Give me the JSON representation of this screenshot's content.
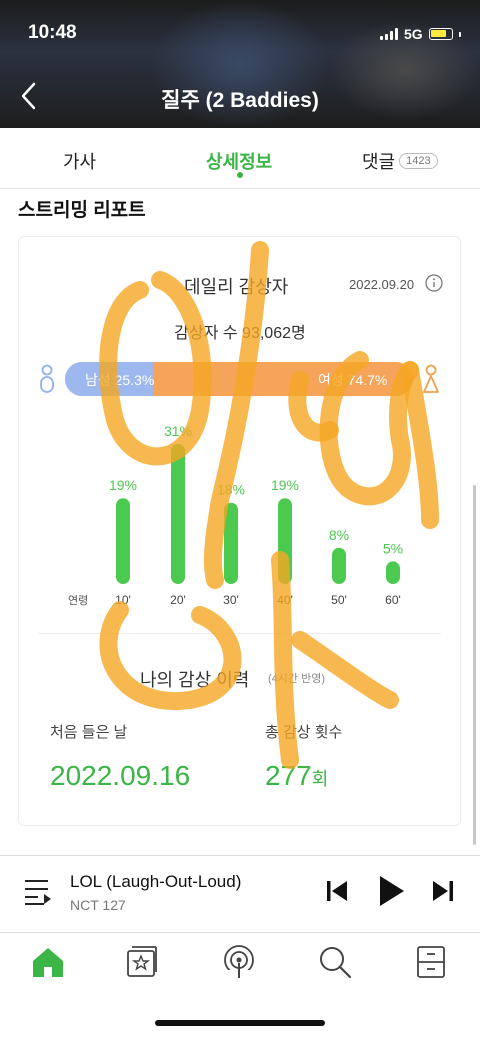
{
  "status_bar": {
    "time": "10:48",
    "network": "5G"
  },
  "header": {
    "title": "질주 (2 Baddies)",
    "back_icon": "chevron-left-icon"
  },
  "tabs": [
    {
      "label": "가사",
      "active": false
    },
    {
      "label": "상세정보",
      "active": true
    },
    {
      "label": "댓글",
      "badge": "1423",
      "active": false
    }
  ],
  "section": {
    "title": "스트리밍 리포트"
  },
  "daily": {
    "title": "데일리 감상자",
    "date": "2022.09.20",
    "listeners_text": "감상자 수 93,062명",
    "male_label": "남성 25.3%",
    "female_label": "여성 74.7%",
    "male_ratio": 0.253,
    "colors": {
      "male": "#9db8ef",
      "female": "#f5a45a",
      "bar_green": "#4cc94f"
    }
  },
  "chart_data": {
    "type": "bar",
    "xlabel": "연령",
    "categories": [
      "10'",
      "20'",
      "30'",
      "40'",
      "50'",
      "60'"
    ],
    "values": [
      19,
      31,
      18,
      19,
      8,
      5
    ],
    "value_labels": [
      "19%",
      "31%",
      "18%",
      "19%",
      "8%",
      "5%"
    ],
    "ylim": [
      0,
      31
    ]
  },
  "history": {
    "title": "나의 감상 이력",
    "note": "(4시간 반영)",
    "first_label": "처음 들은 날",
    "first_value": "2022.09.16",
    "count_label": "총 감상 횟수",
    "count_value": "277",
    "count_unit": "회"
  },
  "player": {
    "song": "LOL (Laugh-Out-Loud)",
    "artist": "NCT 127"
  },
  "bottom_nav": [
    {
      "name": "home-icon",
      "active": true
    },
    {
      "name": "playlist-star-icon",
      "active": false
    },
    {
      "name": "podcast-icon",
      "active": false
    },
    {
      "name": "search-icon",
      "active": false
    },
    {
      "name": "drawer-icon",
      "active": false
    }
  ]
}
